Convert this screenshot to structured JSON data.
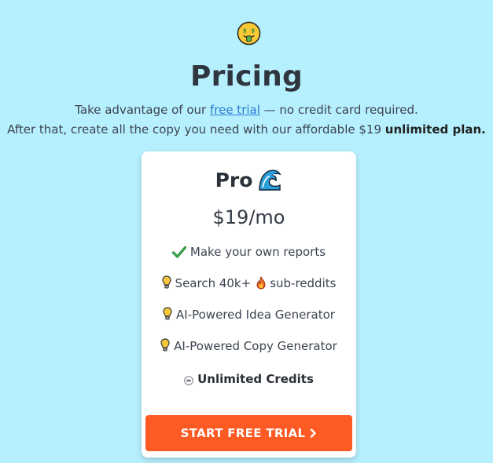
{
  "header": {
    "title": "Pricing",
    "subtitle_line1_pre": "Take advantage of our ",
    "subtitle_line1_link": "free trial",
    "subtitle_line1_post": " — no credit card required.",
    "subtitle_line2_pre": "After that, create all the copy you need with our affordable $19 ",
    "subtitle_line2_bold": "unlimited plan.",
    "icon": "money-mouth-face-icon"
  },
  "plan": {
    "name": "Pro",
    "name_icon": "wave-icon",
    "price": "$19/mo",
    "features": [
      {
        "icon": "checkmark-icon",
        "text": "Make your own reports"
      },
      {
        "icon": "lightbulb-icon",
        "text_pre": "Search 40k+",
        "inline_icon": "fire-icon",
        "text_post": "sub-reddits"
      },
      {
        "icon": "lightbulb-icon",
        "text": "AI-Powered Idea Generator"
      },
      {
        "icon": "lightbulb-icon",
        "text": "AI-Powered Copy Generator"
      },
      {
        "icon": "infinity-icon",
        "text": "Unlimited Credits"
      }
    ],
    "cta_label": "START FREE TRIAL"
  },
  "colors": {
    "background": "#b6f0fe",
    "cta": "#fe5a23",
    "link": "#2a7bd2",
    "card": "#ffffff"
  }
}
